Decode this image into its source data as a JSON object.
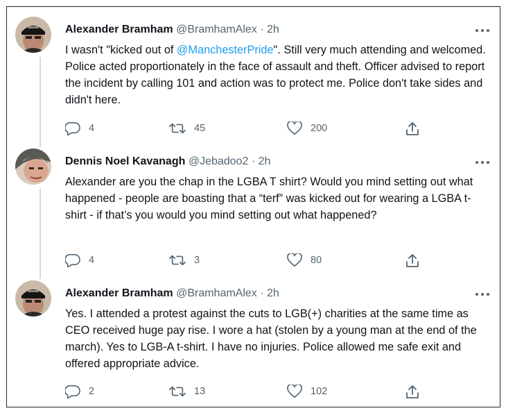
{
  "colors": {
    "accent": "#1d9bf0",
    "secondary_text": "#536471",
    "thread_line": "#cfd9de"
  },
  "tweets": [
    {
      "name": "Alexander Bramham",
      "handle": "@BramhamAlex",
      "separator": "·",
      "time": "2h",
      "more_icon": "more-icon",
      "text_before": "I wasn't \"kicked out of ",
      "mention": "@ManchesterPride",
      "text_after": "\". Still very much attending and welcomed. Police acted proportionately in the face of assault and theft. Officer advised to report the incident by calling 101 and action was to protect me. Police don't take sides and didn't here.",
      "replies": "4",
      "retweets": "45",
      "likes": "200"
    },
    {
      "name": "Dennis Noel Kavanagh",
      "handle": "@Jebadoo2",
      "separator": "·",
      "time": "2h",
      "more_icon": "more-icon",
      "text_before": "Alexander are you the chap in the LGBA T shirt? Would you mind setting out what happened - people are boasting that a “terf” was kicked out for wearing a LGBA t-shirt - if that’s you would you mind setting out what happened?",
      "mention": "",
      "text_after": "",
      "replies": "4",
      "retweets": "3",
      "likes": "80"
    },
    {
      "name": "Alexander Bramham",
      "handle": "@BramhamAlex",
      "separator": "·",
      "time": "2h",
      "more_icon": "more-icon",
      "text_before": "Yes. I attended a protest against the cuts to LGB(+) charities at the same time as CEO received huge pay rise. I wore a hat (stolen by a young man at the end of the march). Yes to LGB-A t-shirt. I have no injuries. Police allowed me safe exit and offered appropriate advice.",
      "mention": "",
      "text_after": "",
      "replies": "2",
      "retweets": "13",
      "likes": "102"
    }
  ]
}
